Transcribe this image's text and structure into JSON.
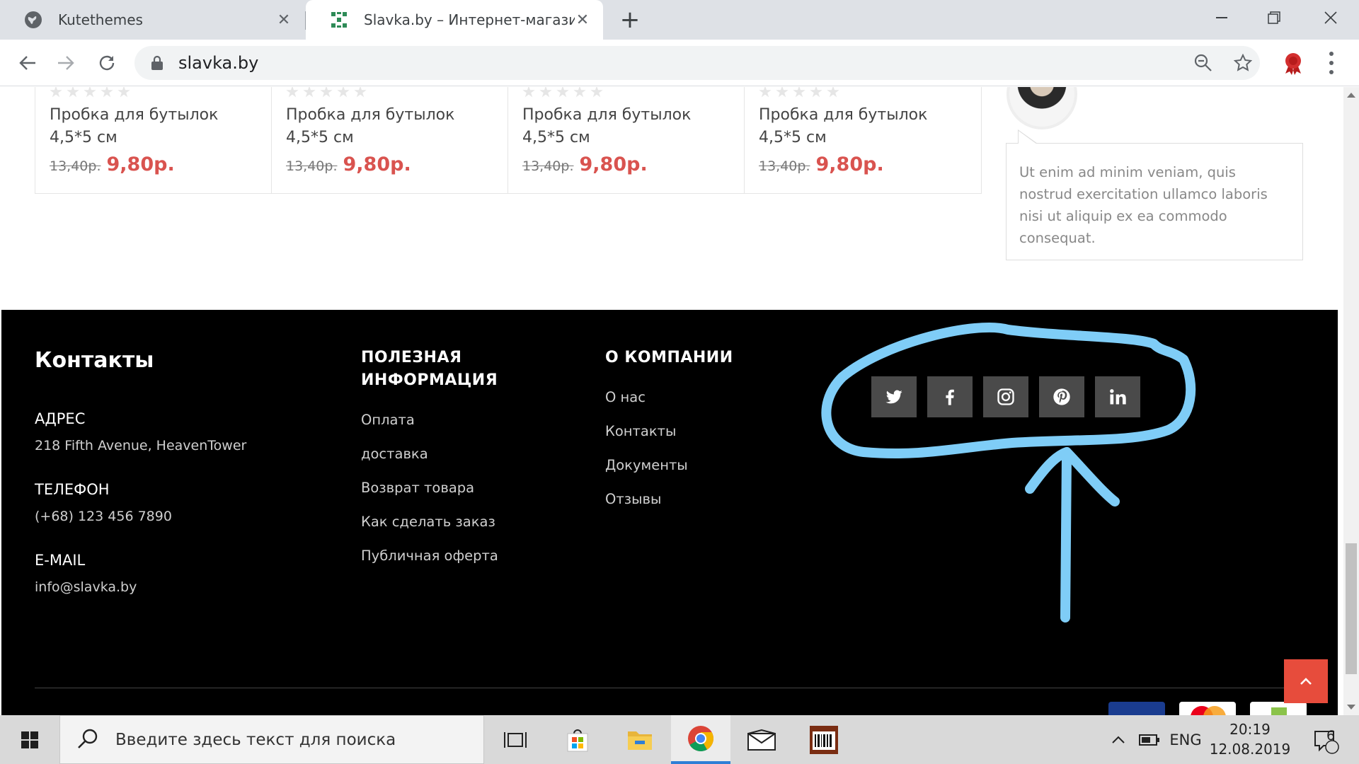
{
  "browser": {
    "tabs": [
      {
        "title": "Kutethemes",
        "active": false
      },
      {
        "title": "Slavka.by – Интернет-магазин о",
        "active": true
      }
    ],
    "address": "slavka.by"
  },
  "products": [
    {
      "name": "Пробка для бутылок 4,5*5 см",
      "old_price": "13,40р.",
      "price": "9,80р."
    },
    {
      "name": "Пробка для бутылок 4,5*5 см",
      "old_price": "13,40р.",
      "price": "9,80р."
    },
    {
      "name": "Пробка для бутылок 4,5*5 см",
      "old_price": "13,40р.",
      "price": "9,80р."
    },
    {
      "name": "Пробка для бутылок 4,5*5 см",
      "old_price": "13,40р.",
      "price": "9,80р."
    }
  ],
  "testimonial": {
    "text": "Ut enim ad minim veniam, quis nostrud exercitation ullamco laboris nisi ut aliquip ex ea commodo consequat."
  },
  "footer": {
    "contacts": {
      "title": "Контакты",
      "address_label": "АДРЕС",
      "address": "218 Fifth Avenue, HeavenTower",
      "phone_label": "ТЕЛЕФОН",
      "phone": "(+68) 123 456 7890",
      "email_label": "E-MAIL",
      "email": "info@slavka.by"
    },
    "useful": {
      "title": "ПОЛЕЗНАЯ ИНФОРМАЦИЯ",
      "links": [
        "Оплата",
        "доставка",
        "Возврат товара",
        "Как сделать заказ",
        "Публичная оферта"
      ]
    },
    "company": {
      "title": "О КОМПАНИИ",
      "links": [
        "О нас",
        "Контакты",
        "Документы",
        "Отзывы"
      ]
    },
    "social": [
      "twitter-icon",
      "facebook-icon",
      "instagram-icon",
      "pinterest-icon",
      "linkedin-icon"
    ]
  },
  "taskbar": {
    "search_placeholder": "Введите здесь текст для поиска",
    "language": "ENG",
    "time": "20:19",
    "date": "12.08.2019",
    "notifications": "6"
  },
  "colors": {
    "price": "#d9534f",
    "footer_bg": "#000000",
    "annotation": "#7fcdf7",
    "back_to_top": "#e74c3c"
  }
}
